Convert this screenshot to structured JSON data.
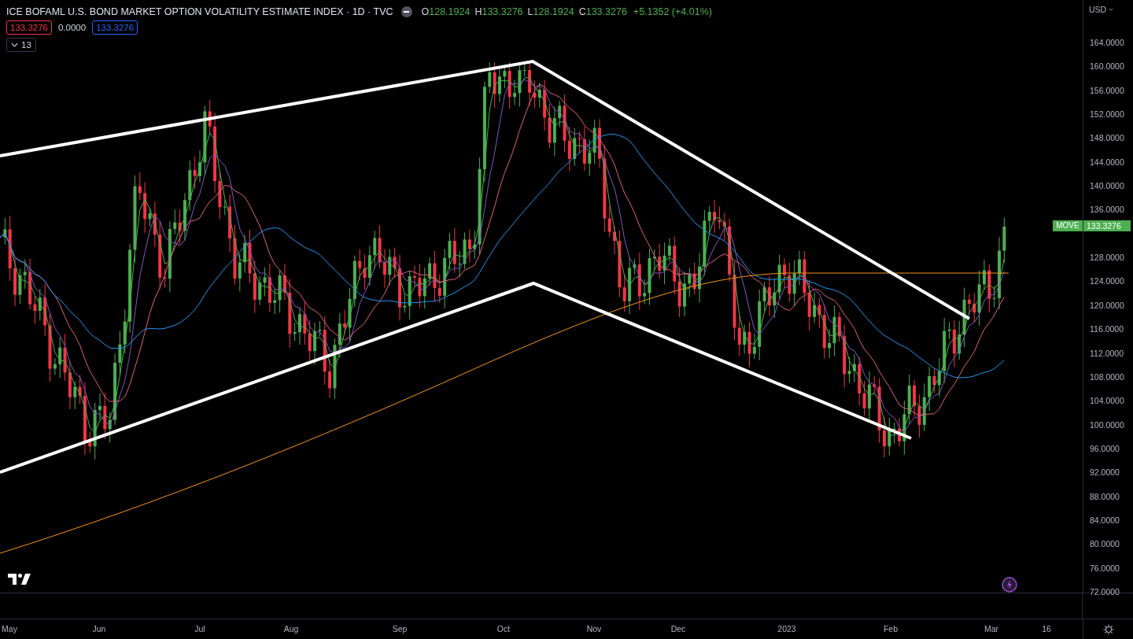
{
  "header": {
    "title": "ICE BOFAML U.S. BOND MARKET OPTION VOLATILITY ESTIMATE INDEX · 1D · TVC",
    "ohlc": [
      {
        "label": "O",
        "value": "128.1924"
      },
      {
        "label": "H",
        "value": "133.3276"
      },
      {
        "label": "L",
        "value": "128.1924"
      },
      {
        "label": "C",
        "value": "133.3276"
      }
    ],
    "change": "+5.1352 (+4.01%)",
    "readings": [
      {
        "text": "133.3276",
        "kind": "boxed",
        "color": "#f23645"
      },
      {
        "text": "0.0000",
        "kind": "plain",
        "color": "#d1d4dc"
      },
      {
        "text": "133.3276",
        "kind": "boxed",
        "color": "#2962ff"
      }
    ],
    "indicators_count": "13"
  },
  "price_axis": {
    "currency": "USD",
    "ticks": [
      "164.0000",
      "160.0000",
      "156.0000",
      "152.0000",
      "148.0000",
      "144.0000",
      "140.0000",
      "136.0000",
      "128.0000",
      "124.0000",
      "120.0000",
      "116.0000",
      "112.0000",
      "108.0000",
      "104.0000",
      "100.0000",
      "96.0000",
      "92.0000",
      "88.0000",
      "84.0000",
      "80.0000",
      "76.0000",
      "72.0000"
    ],
    "last_price": {
      "symbol": "MOVE",
      "value": "133.3276"
    }
  },
  "time_axis": {
    "labels": [
      "May",
      "Jun",
      "Jul",
      "Aug",
      "Sep",
      "Oct",
      "Nov",
      "Dec",
      "2023",
      "Feb",
      "Mar",
      "16"
    ]
  }
}
